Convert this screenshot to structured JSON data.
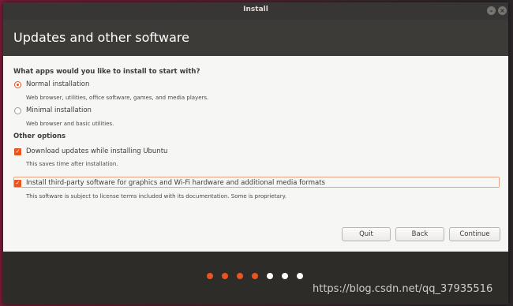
{
  "window": {
    "title": "Install"
  },
  "header": {
    "title": "Updates and other software"
  },
  "install_type": {
    "question": "What apps would you like to install to start with?",
    "options": [
      {
        "label": "Normal installation",
        "description": "Web browser, utilities, office software, games, and media players.",
        "selected": true
      },
      {
        "label": "Minimal installation",
        "description": "Web browser and basic utilities.",
        "selected": false
      }
    ]
  },
  "other_options": {
    "heading": "Other options",
    "items": [
      {
        "label": "Download updates while installing Ubuntu",
        "description": "This saves time after installation.",
        "checked": true
      },
      {
        "label": "Install third-party software for graphics and Wi-Fi hardware and additional media formats",
        "description": "This software is subject to license terms included with its documentation. Some is proprietary.",
        "checked": true
      }
    ]
  },
  "buttons": {
    "quit": "Quit",
    "back": "Back",
    "continue": "Continue"
  },
  "progress": {
    "total_steps": 7,
    "completed_steps": 4
  },
  "watermark": "https://blog.csdn.net/qq_37935516",
  "colors": {
    "accent": "#e95420",
    "header_bg": "#3c3b37",
    "content_bg": "#f6f6f5"
  }
}
